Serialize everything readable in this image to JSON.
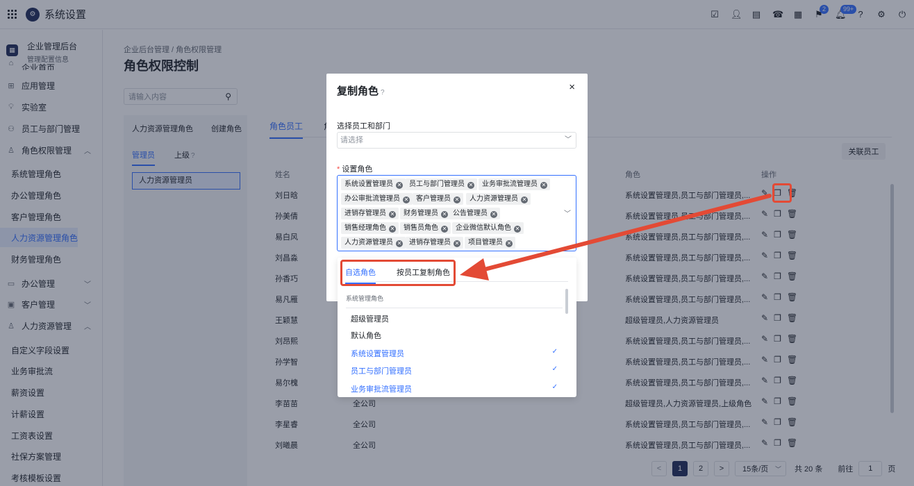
{
  "topbar": {
    "app_title": "系统设置",
    "bell_badge": "99+",
    "flag_badge": "2"
  },
  "sidebar": {
    "enterprise_title": "企业管理后台",
    "enterprise_subtitle": "管理配置信息",
    "partial_item": "企业首页",
    "items": [
      {
        "label": "应用管理",
        "icon": "app-icon"
      },
      {
        "label": "实验室",
        "icon": "bulb-icon"
      },
      {
        "label": "员工与部门管理",
        "icon": "users-icon"
      },
      {
        "label": "角色权限管理",
        "icon": "person-icon"
      }
    ],
    "role_subitems": [
      "系统管理角色",
      "办公管理角色",
      "客户管理角色",
      "人力资源管理角色",
      "财务管理角色"
    ],
    "groups": [
      {
        "label": "办公管理"
      },
      {
        "label": "客户管理"
      },
      {
        "label": "人力资源管理"
      }
    ],
    "hr_subitems": [
      "自定义字段设置",
      "业务审批流",
      "薪资设置",
      "计薪设置",
      "工资表设置",
      "社保方案管理",
      "考核模板设置"
    ]
  },
  "main": {
    "breadcrumb": "企业后台管理  /  角色权限管理",
    "page_title": "角色权限控制",
    "search_placeholder": "请输入内容",
    "role_panel": {
      "tabs": [
        "人力资源管理角色",
        "创建角色"
      ],
      "subtabs": [
        "管理员",
        "上级"
      ],
      "selected_item": "人力资源管理员"
    },
    "right_tabs": [
      "角色员工",
      "角"
    ],
    "assoc_button": "关联员工",
    "table_headers": {
      "name": "姓名",
      "roles": "角色",
      "ops": "操作"
    },
    "rows": [
      {
        "name": "刘日晗",
        "dept": "",
        "roles": "系统设置管理员,员工与部门管理员,..."
      },
      {
        "name": "孙美倩",
        "dept": "",
        "roles": "系统设置管理员,员工与部门管理员,..."
      },
      {
        "name": "易白风",
        "dept": "",
        "roles": "系统设置管理员,员工与部门管理员,..."
      },
      {
        "name": "刘昌淼",
        "dept": "",
        "roles": "系统设置管理员,员工与部门管理员,..."
      },
      {
        "name": "孙香巧",
        "dept": "",
        "roles": "系统设置管理员,员工与部门管理员,..."
      },
      {
        "name": "易凡雁",
        "dept": "",
        "roles": "系统设置管理员,员工与部门管理员,..."
      },
      {
        "name": "王颖慧",
        "dept": "",
        "roles": "超级管理员,人力资源管理员"
      },
      {
        "name": "刘昂熙",
        "dept": "",
        "roles": "系统设置管理员,员工与部门管理员,..."
      },
      {
        "name": "孙学智",
        "dept": "",
        "roles": "系统设置管理员,员工与部门管理员,..."
      },
      {
        "name": "易尔槐",
        "dept": "",
        "roles": "系统设置管理员,员工与部门管理员,..."
      },
      {
        "name": "李苗苗",
        "dept": "全公司",
        "roles": "超级管理员,人力资源管理员,上级角色"
      },
      {
        "name": "李星睿",
        "dept": "全公司",
        "roles": "系统设置管理员,员工与部门管理员,..."
      },
      {
        "name": "刘曦晨",
        "dept": "全公司",
        "roles": "系统设置管理员,员工与部门管理员,..."
      }
    ],
    "pager": {
      "prev": "<",
      "pages": [
        "1",
        "2"
      ],
      "next": ">",
      "page_size": "15条/页",
      "total": "共 20 条",
      "goto_label": "前往",
      "goto_value": "1",
      "page_suffix": "页"
    }
  },
  "modal": {
    "title": "复制角色",
    "close": "×",
    "field1_label": "选择员工和部门",
    "field1_placeholder": "请选择",
    "field2_label": "设置角色",
    "required_mark": "*",
    "tags": [
      "系统设置管理员",
      "员工与部门管理员",
      "业务审批流管理员",
      "办公审批流管理员",
      "客户管理员",
      "人力资源管理员",
      "进销存管理员",
      "财务管理员",
      "公告管理员",
      "销售经理角色",
      "销售员角色",
      "企业微信默认角色",
      "人力资源管理员",
      "进销存管理员",
      "项目管理员"
    ]
  },
  "dropdown": {
    "tabs": [
      "自选角色",
      "按员工复制角色"
    ],
    "group_label": "系统管理角色",
    "options": [
      {
        "label": "超级管理员",
        "selected": false
      },
      {
        "label": "默认角色",
        "selected": false
      },
      {
        "label": "系统设置管理员",
        "selected": true
      },
      {
        "label": "员工与部门管理员",
        "selected": true
      },
      {
        "label": "业务审批流管理员",
        "selected": true
      }
    ]
  },
  "colors": {
    "accent": "#3370ff",
    "annotation": "#e34a35",
    "brand": "#1f2d5a"
  }
}
